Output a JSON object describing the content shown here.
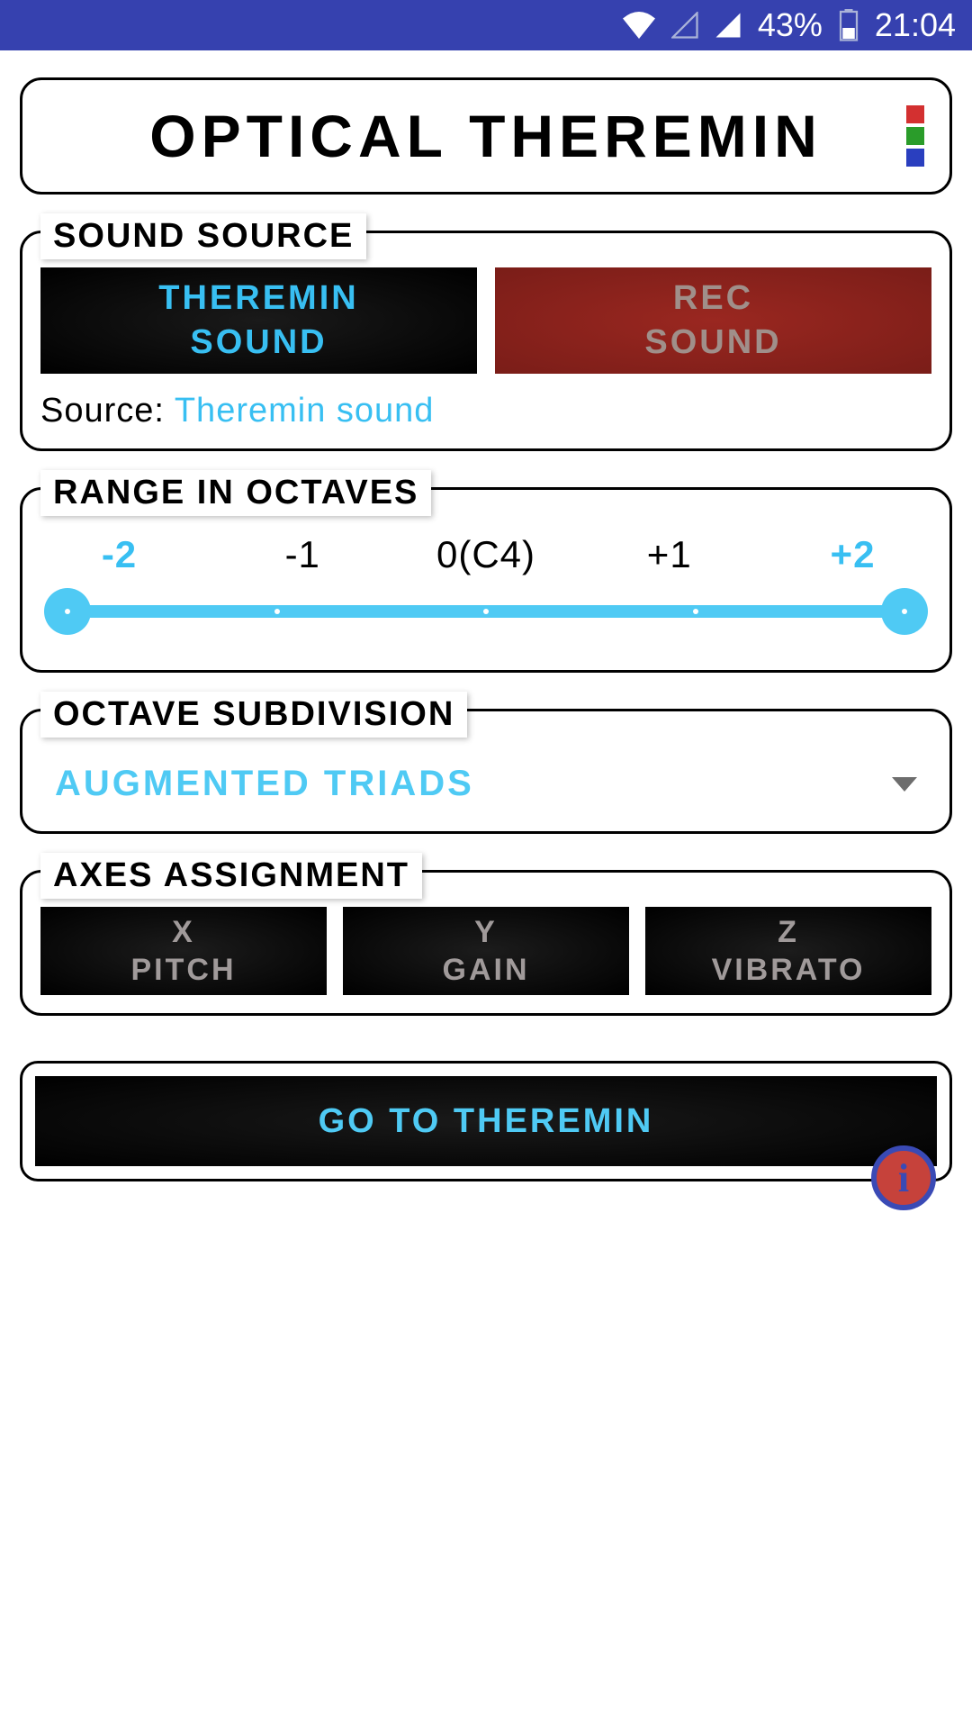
{
  "status": {
    "battery_pct": "43%",
    "time": "21:04"
  },
  "header": {
    "title": "OPTICAL THEREMIN",
    "flag_colors": [
      "#d33030",
      "#2a9c2a",
      "#2a3fbf"
    ]
  },
  "sections": {
    "sound": {
      "legend": "SOUND SOURCE",
      "btn_theremin": "THEREMIN\nSOUND",
      "btn_rec": "REC\nSOUND",
      "source_label": "Source: ",
      "source_value": "Theremin sound"
    },
    "range": {
      "legend": "RANGE IN OCTAVES",
      "labels": [
        "-2",
        "-1",
        "0(C4)",
        "+1",
        "+2"
      ],
      "min_pct": 0,
      "max_pct": 100
    },
    "subdivision": {
      "legend": "OCTAVE SUBDIVISION",
      "selected": "AUGMENTED TRIADS"
    },
    "axes": {
      "legend": "AXES ASSIGNMENT",
      "items": [
        {
          "axis": "X",
          "param": "PITCH"
        },
        {
          "axis": "Y",
          "param": "GAIN"
        },
        {
          "axis": "Z",
          "param": "VIBRATO"
        }
      ]
    }
  },
  "go_button": "GO TO THEREMIN",
  "info_icon": "i"
}
